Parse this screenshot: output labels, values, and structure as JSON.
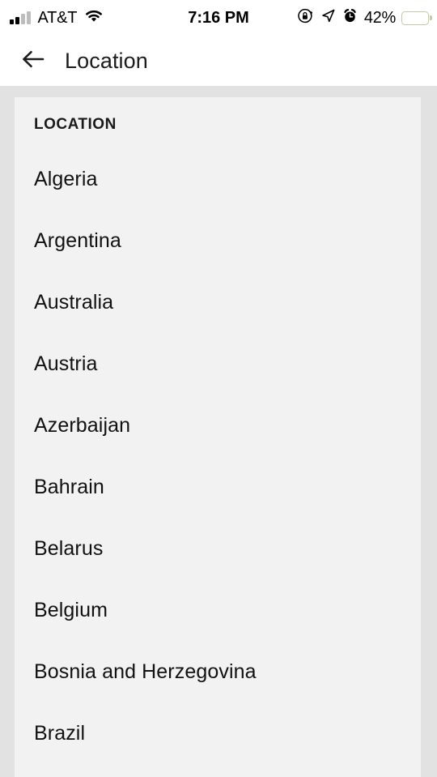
{
  "status_bar": {
    "carrier": "AT&T",
    "time": "7:16 PM",
    "battery_percent": "42%",
    "battery_level": 42,
    "icons": {
      "signal": "signal-bars-icon",
      "wifi": "wifi-icon",
      "rotation_lock": "rotation-lock-icon",
      "location": "location-arrow-icon",
      "alarm": "alarm-clock-icon",
      "battery": "battery-icon"
    },
    "colors": {
      "battery_fill": "#ffd60a",
      "signal_active": "#000000",
      "signal_inactive": "#bdbdbd"
    }
  },
  "nav_bar": {
    "back_icon": "arrow-left-icon",
    "title": "Location"
  },
  "content": {
    "section_header": "LOCATION",
    "items": [
      {
        "label": "Algeria"
      },
      {
        "label": "Argentina"
      },
      {
        "label": "Australia"
      },
      {
        "label": "Austria"
      },
      {
        "label": "Azerbaijan"
      },
      {
        "label": "Bahrain"
      },
      {
        "label": "Belarus"
      },
      {
        "label": "Belgium"
      },
      {
        "label": "Bosnia and Herzegovina"
      },
      {
        "label": "Brazil"
      }
    ]
  },
  "theme": {
    "page_background": "#e2e2e2",
    "card_background": "#f2f2f2",
    "bar_background": "#ffffff",
    "text_primary": "#111111"
  }
}
